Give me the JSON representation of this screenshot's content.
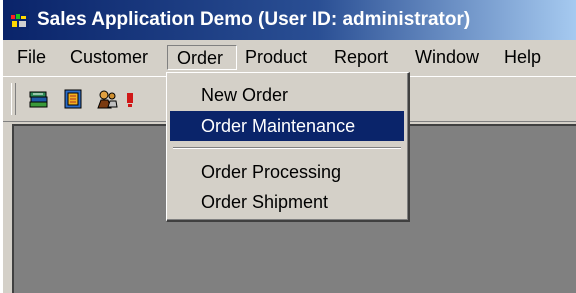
{
  "window": {
    "title": "Sales Application Demo (User ID: administrator)"
  },
  "menubar": {
    "items": [
      {
        "label": "File"
      },
      {
        "label": "Customer"
      },
      {
        "label": "Order"
      },
      {
        "label": "Product"
      },
      {
        "label": "Report"
      },
      {
        "label": "Window"
      },
      {
        "label": "Help"
      }
    ],
    "active_menu": "Order"
  },
  "toolbar": {
    "buttons": [
      {
        "icon": "books-icon"
      },
      {
        "icon": "document-icon"
      },
      {
        "icon": "people-icon"
      },
      {
        "icon": "red-partial-icon"
      }
    ]
  },
  "order_menu": {
    "items": [
      {
        "label": "New Order"
      },
      {
        "label": "Order Maintenance",
        "highlighted": true
      },
      {
        "label": "Order Processing"
      },
      {
        "label": "Order Shipment"
      }
    ]
  },
  "colors": {
    "title_gradient_start": "#0a246a",
    "title_gradient_end": "#a6caf0",
    "menu_highlight": "#0a246a",
    "face": "#d4d0c8",
    "mdi_background": "#808080"
  }
}
